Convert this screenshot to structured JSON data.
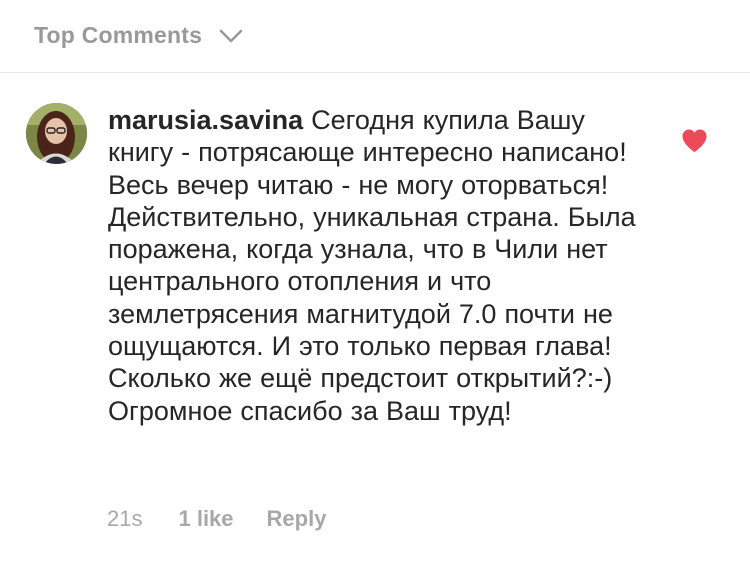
{
  "header": {
    "label": "Top Comments",
    "chevron_icon": "chevron-down-icon"
  },
  "comment": {
    "avatar_icon": "user-avatar",
    "username": "marusia.savina",
    "text": "Сегодня купила Вашу книгу - потрясающе интересно написано! Весь вечер читаю - не могу оторваться! Действительно, уникальная страна. Была поражена, когда узнала, что в Чили нет центрального отопления  и что землетрясения магнитудой 7.0 почти не ощущаются. И это только первая глава! Сколько же ещё предстоит открытий?:-) Огромное спасибо за Ваш труд!",
    "time": "21s",
    "likes": "1 like",
    "reply": "Reply",
    "like_icon": "heart-icon",
    "like_color": "#ed4956"
  },
  "colors": {
    "text": "#262626",
    "muted": "#999999",
    "meta": "#a8a8a8"
  }
}
